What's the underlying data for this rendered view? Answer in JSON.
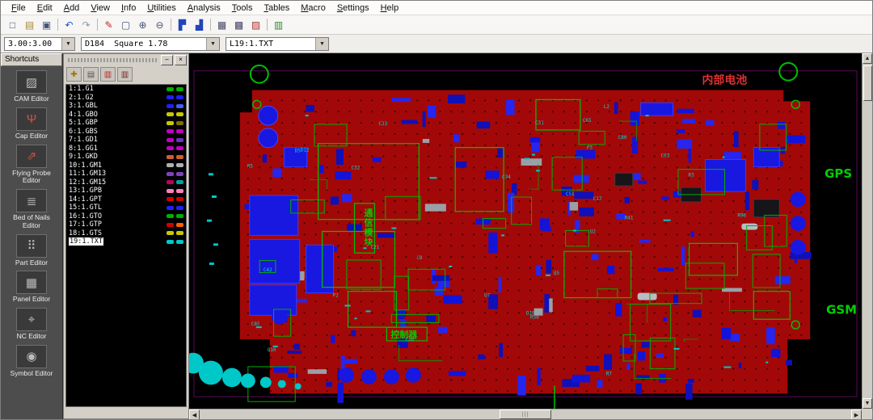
{
  "menu": {
    "items": [
      "File",
      "Edit",
      "Add",
      "View",
      "Info",
      "Utilities",
      "Analysis",
      "Tools",
      "Tables",
      "Macro",
      "Settings",
      "Help"
    ]
  },
  "toolbar": {
    "items": [
      {
        "name": "new-file-icon",
        "glyph": "□",
        "color": "#445577"
      },
      {
        "name": "open-folder-icon",
        "glyph": "▤",
        "color": "#aa8833"
      },
      {
        "name": "save-icon",
        "glyph": "▣",
        "color": "#445577"
      },
      {
        "sep": true
      },
      {
        "name": "undo-icon",
        "glyph": "↶",
        "color": "#2255cc"
      },
      {
        "name": "redo-icon",
        "glyph": "↷",
        "color": "#8899aa"
      },
      {
        "sep": true
      },
      {
        "name": "redline-icon",
        "glyph": "✎",
        "color": "#cc2222"
      },
      {
        "name": "zoom-window-icon",
        "glyph": "▢",
        "color": "#445577"
      },
      {
        "name": "zoom-in-icon",
        "glyph": "⊕",
        "color": "#445577"
      },
      {
        "name": "zoom-out-icon",
        "glyph": "⊖",
        "color": "#445577"
      },
      {
        "sep": true
      },
      {
        "name": "board-top-view-icon",
        "glyph": "▛",
        "color": "#2244bb"
      },
      {
        "name": "board-bottom-view-icon",
        "glyph": "▟",
        "color": "#2244bb"
      },
      {
        "sep": true
      },
      {
        "name": "grid-dots-icon",
        "glyph": "▦",
        "color": "#444466"
      },
      {
        "name": "grid-lines-icon",
        "glyph": "▩",
        "color": "#444466"
      },
      {
        "name": "grid-color-icon",
        "glyph": "▨",
        "color": "#aa3333"
      },
      {
        "sep": true
      },
      {
        "name": "macro-film-icon",
        "glyph": "▥",
        "color": "#338833"
      }
    ]
  },
  "controls": {
    "grid_value": "3.00:3.00",
    "dcode_value": "D184  Square 1.78",
    "layer_value": "L19:1.TXT"
  },
  "shortcuts": {
    "title": "Shortcuts",
    "items": [
      {
        "name": "cam-editor",
        "label": "CAM Editor",
        "glyph": "▨",
        "color": "#bcbcbc"
      },
      {
        "name": "cap-editor",
        "label": "Cap Editor",
        "glyph": "Ψ",
        "color": "#cc5544"
      },
      {
        "name": "flying-probe-editor",
        "label": "Flying Probe Editor",
        "glyph": "⇗",
        "color": "#cc5544"
      },
      {
        "name": "bed-of-nails-editor",
        "label": "Bed of Nails Editor",
        "glyph": "≣",
        "color": "#bcbcbc"
      },
      {
        "name": "part-editor",
        "label": "Part Editor",
        "glyph": "⠿",
        "color": "#bcbcbc"
      },
      {
        "name": "panel-editor",
        "label": "Panel Editor",
        "glyph": "▦",
        "color": "#bcbcbc"
      },
      {
        "name": "nc-editor",
        "label": "NC Editor",
        "glyph": "⌖",
        "color": "#bcbcbc"
      },
      {
        "name": "symbol-editor",
        "label": "Symbol Editor",
        "glyph": "◉",
        "color": "#bcbcbc"
      }
    ]
  },
  "layers_panel": {
    "minimize_label": "–",
    "close_label": "×",
    "tools": [
      {
        "name": "add-layers-icon",
        "glyph": "✚",
        "color": "#997700"
      },
      {
        "name": "film-box-icon",
        "glyph": "▤",
        "color": "#555555"
      },
      {
        "name": "film-red-icon",
        "glyph": "▥",
        "color": "#bb2222"
      },
      {
        "name": "film-dark-icon",
        "glyph": "▥",
        "color": "#772222"
      }
    ],
    "items": [
      {
        "label": "1:1.G1",
        "c1": "#00b000",
        "c2": "#00b000",
        "selected": false
      },
      {
        "label": "2:1.G2",
        "c1": "#2020ff",
        "c2": "#2020ff",
        "selected": false
      },
      {
        "label": "3:1.GBL",
        "c1": "#2020ff",
        "c2": "#4060ff",
        "selected": false
      },
      {
        "label": "4:1.GBO",
        "c1": "#c8c800",
        "c2": "#c8c800",
        "selected": false
      },
      {
        "label": "5:1.GBP",
        "c1": "#c8c800",
        "c2": "#807000",
        "selected": false
      },
      {
        "label": "6:1.GBS",
        "c1": "#c000c0",
        "c2": "#c000c0",
        "selected": false
      },
      {
        "label": "7:1.GD1",
        "c1": "#c000c0",
        "c2": "#7030c0",
        "selected": false
      },
      {
        "label": "8:1.GG1",
        "c1": "#c000c0",
        "c2": "#c000c0",
        "selected": false
      },
      {
        "label": "9:1.GKD",
        "c1": "#d06030",
        "c2": "#d06030",
        "selected": false
      },
      {
        "label": "10:1.GM1",
        "c1": "#b0b0b0",
        "c2": "#b0b0b0",
        "selected": false
      },
      {
        "label": "11:1.GM13",
        "c1": "#8040c0",
        "c2": "#8040c0",
        "selected": false
      },
      {
        "label": "12:1.GM15",
        "c1": "#c00060",
        "c2": "#00a0a0",
        "selected": false
      },
      {
        "label": "13:1.GPB",
        "c1": "#ff80c0",
        "c2": "#ff80c0",
        "selected": false
      },
      {
        "label": "14:1.GPT",
        "c1": "#d00000",
        "c2": "#d00000",
        "selected": false
      },
      {
        "label": "15:1.GTL",
        "c1": "#2020ff",
        "c2": "#2020ff",
        "selected": false
      },
      {
        "label": "16:1.GTO",
        "c1": "#00b000",
        "c2": "#00b000",
        "selected": false
      },
      {
        "label": "17:1.GTP",
        "c1": "#d00000",
        "c2": "#ff6000",
        "selected": false
      },
      {
        "label": "18:1.GTS",
        "c1": "#c8c800",
        "c2": "#c8c800",
        "selected": false
      },
      {
        "label": "19:1.TXT",
        "c1": "#00c8c8",
        "c2": "#00c8c8",
        "selected": true
      }
    ]
  },
  "canvas": {
    "board_color": "#a30808",
    "component_color": "#1616dd",
    "outline_color": "#00c000",
    "highlight_color": "#00c8c8",
    "labels": [
      {
        "text": "内部电池",
        "color": "#e03030"
      },
      {
        "text": "GPS",
        "color": "#00d000"
      },
      {
        "text": "GSM",
        "color": "#00d000"
      },
      {
        "text": "通信模块",
        "color": "#00d000"
      },
      {
        "text": "控制器",
        "color": "#00d000"
      }
    ],
    "refdes": [
      "C80",
      "C8",
      "P2",
      "R3",
      "R5",
      "U2",
      "C63",
      "C33",
      "C32",
      "Q5",
      "D19",
      "C21",
      "C36",
      "C34",
      "L2",
      "R41",
      "C65",
      "C51",
      "D5",
      "R96",
      "C31",
      "R7",
      "P3",
      "C85",
      "D12",
      "U7",
      "C42",
      "R58",
      "C17",
      "Q10"
    ]
  }
}
